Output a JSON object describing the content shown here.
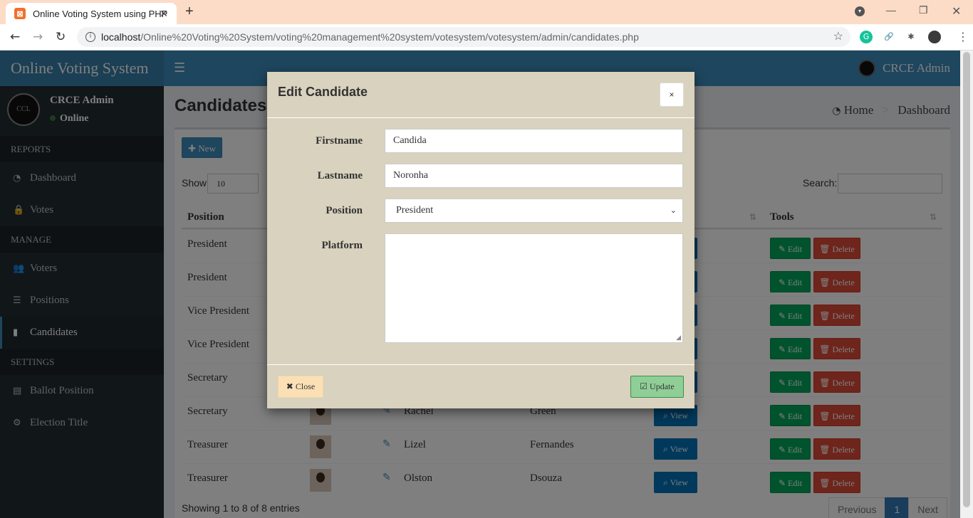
{
  "browser": {
    "tab_title": "Online Voting System using PHP",
    "url_host": "localhost",
    "url_path": "/Online%20Voting%20System/voting%20management%20system/votesystem/votesystem/admin/candidates.php"
  },
  "app": {
    "logo_text": "Online Voting System",
    "admin_name": "CRCE Admin",
    "user_status": "Online",
    "avatar_initials": "CCL"
  },
  "sidebar": {
    "reports_header": "REPORTS",
    "manage_header": "MANAGE",
    "settings_header": "SETTINGS",
    "dashboard": "Dashboard",
    "votes": "Votes",
    "voters": "Voters",
    "positions": "Positions",
    "candidates": "Candidates",
    "ballot_position": "Ballot Position",
    "election_title": "Election Title"
  },
  "page": {
    "title": "Candidates List",
    "breadcrumb_home": "Home",
    "breadcrumb_current": "Dashboard",
    "new_button": "New",
    "show_label": "Show",
    "show_value": "10",
    "search_label": "Search:",
    "info_text": "Showing 1 to 8 of 8 entries",
    "prev_label": "Previous",
    "page_number": "1",
    "next_label": "Next"
  },
  "table": {
    "col_position": "Position",
    "col_tools": "Tools",
    "view_label": "View",
    "edit_label": "Edit",
    "delete_label": "Delete",
    "rows": [
      {
        "position": "President",
        "firstname": "",
        "lastname": ""
      },
      {
        "position": "President",
        "firstname": "",
        "lastname": ""
      },
      {
        "position": "Vice President",
        "firstname": "",
        "lastname": ""
      },
      {
        "position": "Vice President",
        "firstname": "",
        "lastname": ""
      },
      {
        "position": "Secretary",
        "firstname": "",
        "lastname": ""
      },
      {
        "position": "Secretary",
        "firstname": "Rachel",
        "lastname": "Green"
      },
      {
        "position": "Treasurer",
        "firstname": "Lizel",
        "lastname": "Fernandes"
      },
      {
        "position": "Treasurer",
        "firstname": "Olston",
        "lastname": "Dsouza"
      }
    ]
  },
  "modal": {
    "title": "Edit Candidate",
    "close_x": "×",
    "firstname_label": "Firstname",
    "firstname_value": "Candida",
    "lastname_label": "Lastname",
    "lastname_value": "Noronha",
    "position_label": "Position",
    "position_value": "President",
    "platform_label": "Platform",
    "platform_value": "",
    "close_button": "Close",
    "update_button": "Update"
  },
  "colors": {
    "primary": "#3c8dbc",
    "sidebar": "#222d32",
    "modal_bg": "#d8d2be",
    "success": "#00a65a",
    "danger": "#dd4b39"
  }
}
